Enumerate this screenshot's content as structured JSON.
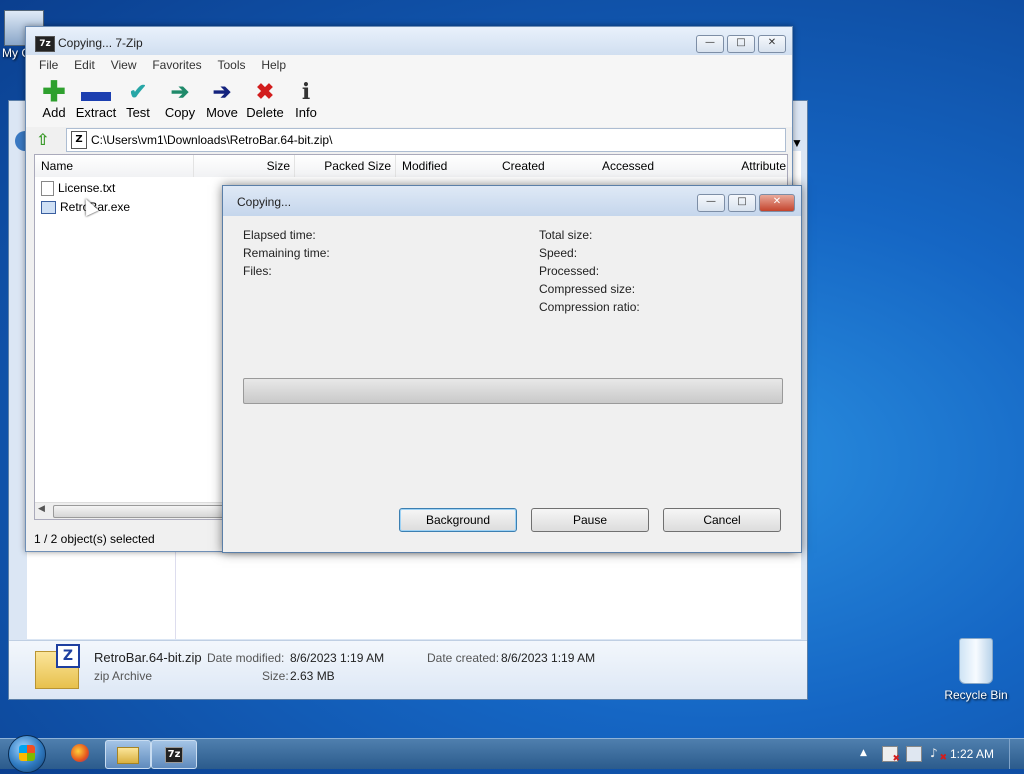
{
  "desktop": {
    "icons": [
      {
        "label": "My C"
      },
      {
        "label": "Recycle Bin"
      }
    ]
  },
  "explorer": {
    "file_name": "RetroBar.64-bit.zip",
    "file_type": "zip Archive",
    "date_modified_label": "Date modified:",
    "date_modified": "8/6/2023 1:19 AM",
    "date_created_label": "Date created:",
    "date_created": "8/6/2023 1:19 AM",
    "size_label": "Size:",
    "size": "2.63 MB"
  },
  "zip": {
    "title": "Copying... 7-Zip",
    "app_icon": "7z",
    "menu": [
      "File",
      "Edit",
      "View",
      "Favorites",
      "Tools",
      "Help"
    ],
    "toolbar": [
      {
        "label": "Add",
        "icon": "plus",
        "color": "#2ea02e"
      },
      {
        "label": "Extract",
        "icon": "minus",
        "color": "#1c3fb0"
      },
      {
        "label": "Test",
        "icon": "check",
        "color": "#27a6a6"
      },
      {
        "label": "Copy",
        "icon": "arrow-right",
        "color": "#1f8a6a"
      },
      {
        "label": "Move",
        "icon": "arrow-right",
        "color": "#14237e"
      },
      {
        "label": "Delete",
        "icon": "x",
        "color": "#d21d1d"
      },
      {
        "label": "Info",
        "icon": "info",
        "color": "#333333"
      }
    ],
    "path": "C:\\Users\\vm1\\Downloads\\RetroBar.64-bit.zip\\",
    "columns": [
      "Name",
      "Size",
      "Packed Size",
      "Modified",
      "Created",
      "Accessed",
      "Attribute"
    ],
    "files": [
      {
        "name": "License.txt"
      },
      {
        "name": "RetroBar.exe"
      }
    ],
    "status": "1 / 2 object(s) selected"
  },
  "dialog": {
    "title": "Copying...",
    "left_labels": [
      "Elapsed time:",
      "Remaining time:",
      "Files:"
    ],
    "right_labels": [
      "Total size:",
      "Speed:",
      "Processed:",
      "Compressed size:",
      "Compression ratio:"
    ],
    "progress": 0,
    "buttons": {
      "background": "Background",
      "pause": "Pause",
      "cancel": "Cancel"
    }
  },
  "taskbar": {
    "clock": "1:22 AM",
    "app_label": "7z"
  }
}
